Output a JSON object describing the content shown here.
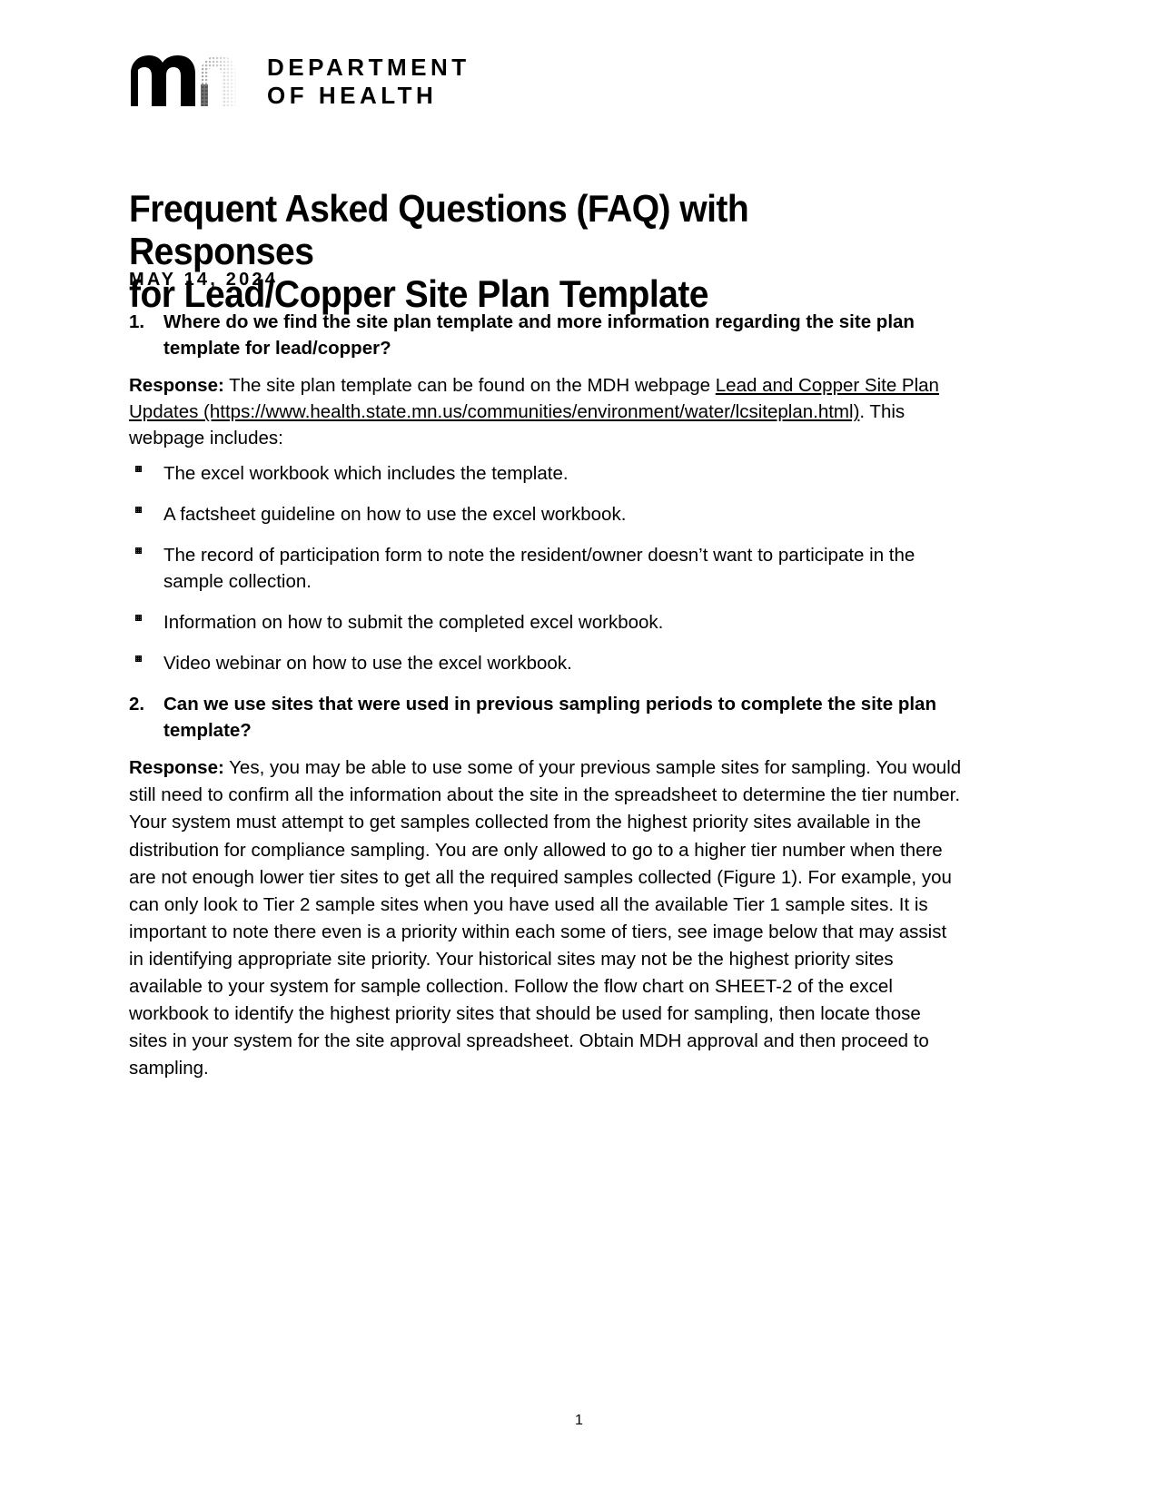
{
  "logo": {
    "mark_alt": "mn-state-of-minnesota-logo",
    "line1": "DEPARTMENT",
    "line2": "OF HEALTH"
  },
  "document": {
    "title_line1": "Frequent Asked Questions (FAQ) with Responses",
    "title_line2": "for Lead/Copper Site Plan Template",
    "date": "MAY 14, 2024",
    "page_number": "1"
  },
  "faq": [
    {
      "number": "1.",
      "question": "Where do we find the site plan template and more information regarding the site plan template for lead/copper?",
      "response_label": "Response:",
      "response_intro": " The site plan template can be found on the MDH webpage ",
      "link_text": "Lead and Copper Site Plan Updates (https://www.health.state.mn.us/communities/environment/water/lcsiteplan.html)",
      "response_outro": ". This webpage includes:",
      "bullets": [
        "The excel workbook which includes the template.",
        "A factsheet guideline on how to use the excel workbook.",
        "The record of participation form to note the resident/owner doesn’t want to participate in the sample collection.",
        "Information on how to submit the completed excel workbook.",
        "Video webinar on how to use the excel workbook."
      ]
    },
    {
      "number": "2.",
      "question": "Can we use sites that were used in previous sampling periods to complete the site plan template?",
      "response_label": "Response:",
      "response_body": " Yes, you may be able to use some of your previous sample sites for sampling. You would still need to confirm all the information about the site in the spreadsheet to determine the tier number. Your system must attempt to get samples collected from the highest priority sites available in the distribution for compliance sampling. You are only allowed to go to a higher tier number when there are not enough lower tier sites to get all the required samples collected (Figure 1). For example, you can only look to Tier 2 sample sites when you have used all the available Tier 1 sample sites.  It is important to note there even is a priority within each some of tiers, see image below that may assist in identifying appropriate site priority.  Your historical sites may not be the highest priority sites available to your system for sample collection. Follow the flow chart on SHEET-2 of the excel workbook to identify the highest priority sites that should be used for sampling, then locate those sites in your system for the site approval spreadsheet.  Obtain MDH approval and then proceed to sampling."
    }
  ],
  "colors": {
    "text": "#000000",
    "background": "#ffffff"
  }
}
